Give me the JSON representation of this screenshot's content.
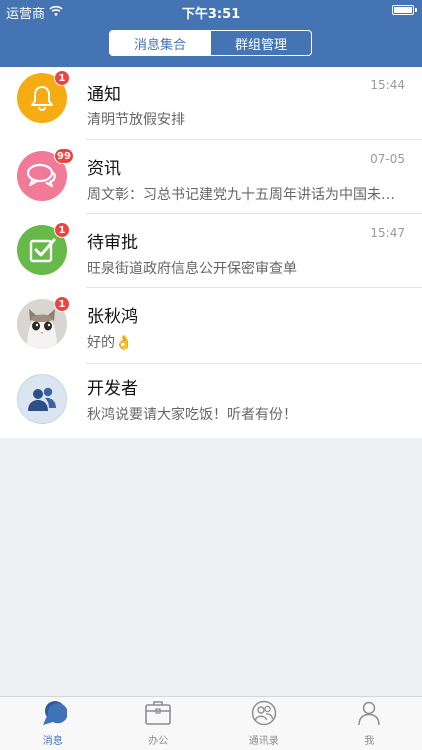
{
  "status_bar": {
    "carrier": "运营商",
    "time": "下午3:51"
  },
  "header": {
    "segments": [
      {
        "label": "消息集合",
        "active": true
      },
      {
        "label": "群组管理",
        "active": false
      }
    ]
  },
  "messages": [
    {
      "title": "通知",
      "subtitle": "清明节放假安排",
      "time": "15:44",
      "badge": "1",
      "icon": "bell-icon",
      "color": "#f5ac12"
    },
    {
      "title": "资讯",
      "subtitle": "周文彰：习总书记建党九十五周年讲话为中国未…",
      "time": "07-05",
      "badge": "99",
      "icon": "chat-bubbles-icon",
      "color": "#f07a97"
    },
    {
      "title": "待审批",
      "subtitle": "旺泉街道政府信息公开保密审查单",
      "time": "15:47",
      "badge": "1",
      "icon": "checkbox-icon",
      "color": "#67b949"
    },
    {
      "title": "张秋鸿",
      "subtitle": "好的",
      "subtitle_emoji": "👌",
      "time": "",
      "badge": "1",
      "icon": "cat-photo-avatar"
    },
    {
      "title": "开发者",
      "subtitle": "秋鸿说要请大家吃饭！听者有份！",
      "time": "",
      "badge": "",
      "icon": "group-people-icon",
      "color": "#dbe5f1"
    }
  ],
  "tabbar": {
    "items": [
      {
        "label": "消息",
        "icon": "message-icon",
        "active": true
      },
      {
        "label": "办公",
        "icon": "briefcase-icon",
        "active": false
      },
      {
        "label": "通讯录",
        "icon": "contacts-icon",
        "active": false
      },
      {
        "label": "我",
        "icon": "person-icon",
        "active": false
      }
    ]
  },
  "colors": {
    "header": "#4474b3",
    "badge": "#f0433f",
    "active_tab": "#3f73b8"
  }
}
